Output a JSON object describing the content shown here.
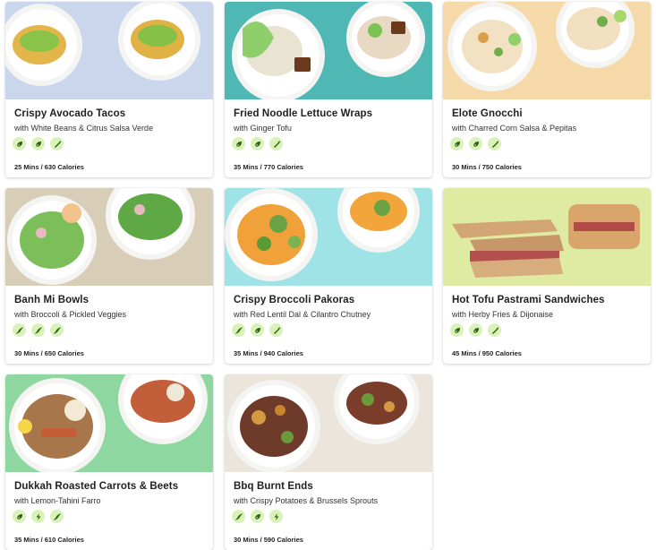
{
  "recipes": [
    {
      "title": "Crispy Avocado Tacos",
      "subtitle": "with White Beans & Citrus Salsa Verde",
      "meta": "25 Mins / 630 Calories",
      "bg": "#c9d6ec",
      "badges": [
        "leaf-icon",
        "leaf-icon",
        "carrot-icon"
      ]
    },
    {
      "title": "Fried Noodle Lettuce Wraps",
      "subtitle": "with Ginger Tofu",
      "meta": "35 Mins / 770 Calories",
      "bg": "#4fb8b5",
      "badges": [
        "leaf-icon",
        "leaf-icon",
        "carrot-icon"
      ]
    },
    {
      "title": "Elote Gnocchi",
      "subtitle": "with Charred Corn Salsa & Pepitas",
      "meta": "30 Mins / 750 Calories",
      "bg": "#f6d9a9",
      "badges": [
        "leaf-icon",
        "leaf-icon",
        "carrot-icon"
      ]
    },
    {
      "title": "Banh Mi Bowls",
      "subtitle": "with Broccoli & Pickled Veggies",
      "meta": "30 Mins / 650 Calories",
      "bg": "#d8cdb7",
      "badges": [
        "no-dairy-icon",
        "no-dairy-icon",
        "no-dairy-icon"
      ]
    },
    {
      "title": "Crispy Broccoli Pakoras",
      "subtitle": "with Red Lentil Dal & Cilantro Chutney",
      "meta": "35 Mins / 940 Calories",
      "bg": "#9fe3e6",
      "badges": [
        "no-dairy-icon",
        "leaf-icon",
        "carrot-icon"
      ]
    },
    {
      "title": "Hot Tofu Pastrami Sandwiches",
      "subtitle": "with Herby Fries & Dijonaise",
      "meta": "45 Mins / 950 Calories",
      "bg": "#dfeaa2",
      "badges": [
        "leaf-icon",
        "leaf-icon",
        "carrot-icon"
      ]
    },
    {
      "title": "Dukkah Roasted Carrots & Beets",
      "subtitle": "with Lemon-Tahini Farro",
      "meta": "35 Mins / 610 Calories",
      "bg": "#8fd7a0",
      "badges": [
        "leaf-icon",
        "bolt-icon",
        "no-dairy-icon"
      ]
    },
    {
      "title": "Bbq Burnt Ends",
      "subtitle": "with Crispy Potatoes & Brussels Sprouts",
      "meta": "30 Mins / 590 Calories",
      "bg": "#ece5dc",
      "badges": [
        "no-dairy-icon",
        "leaf-icon",
        "bolt-icon"
      ]
    }
  ]
}
